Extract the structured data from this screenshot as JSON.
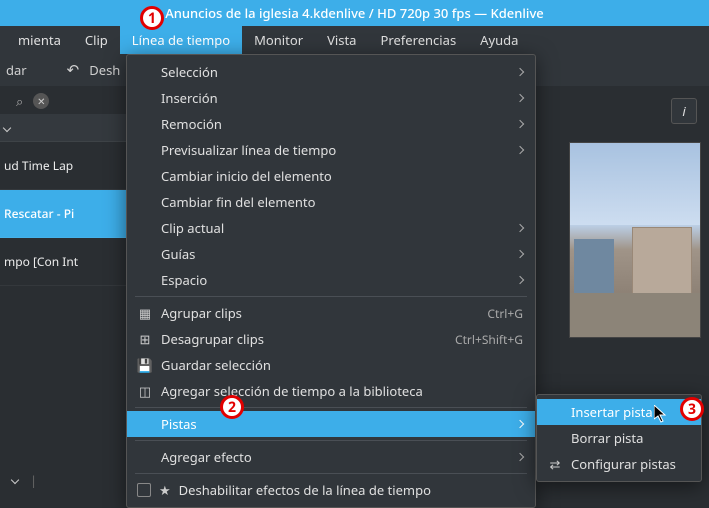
{
  "window_title": "Anuncios de la iglesia 4.kdenlive / HD 720p 30 fps — Kdenlive",
  "menubar": {
    "items": [
      "mienta",
      "Clip",
      "Línea de tiempo",
      "Monitor",
      "Vista",
      "Preferencias",
      "Ayuda"
    ],
    "active_index": 2
  },
  "toolbar": {
    "redo_fragment": "dar",
    "undo_label": "Desh"
  },
  "clips": {
    "row1": "ud Time Lap",
    "row2": "Rescatar - Pi",
    "row3": "mpo [Con Int"
  },
  "menu1": {
    "seleccion": "Selección",
    "insercion": "Inserción",
    "remocion": "Remoción",
    "previsualizar": "Previsualizar línea de tiempo",
    "cambiar_inicio": "Cambiar inicio del elemento",
    "cambiar_fin": "Cambiar fin del elemento",
    "clip_actual": "Clip actual",
    "guias": "Guías",
    "espacio": "Espacio",
    "agrupar": "Agrupar clips",
    "agrupar_sc": "Ctrl+G",
    "desagrupar": "Desagrupar clips",
    "desagrupar_sc": "Ctrl+Shift+G",
    "guardar_sel": "Guardar selección",
    "agregar_bib": "Agregar selección de tiempo a la biblioteca",
    "pistas": "Pistas",
    "agregar_efecto": "Agregar efecto",
    "deshabilitar": "Deshabilitar efectos de la línea de tiempo"
  },
  "menu2": {
    "insertar": "Insertar pista",
    "borrar": "Borrar pista",
    "configurar": "Configurar pistas"
  },
  "annotations": {
    "b1": "1",
    "b2": "2",
    "b3": "3"
  }
}
